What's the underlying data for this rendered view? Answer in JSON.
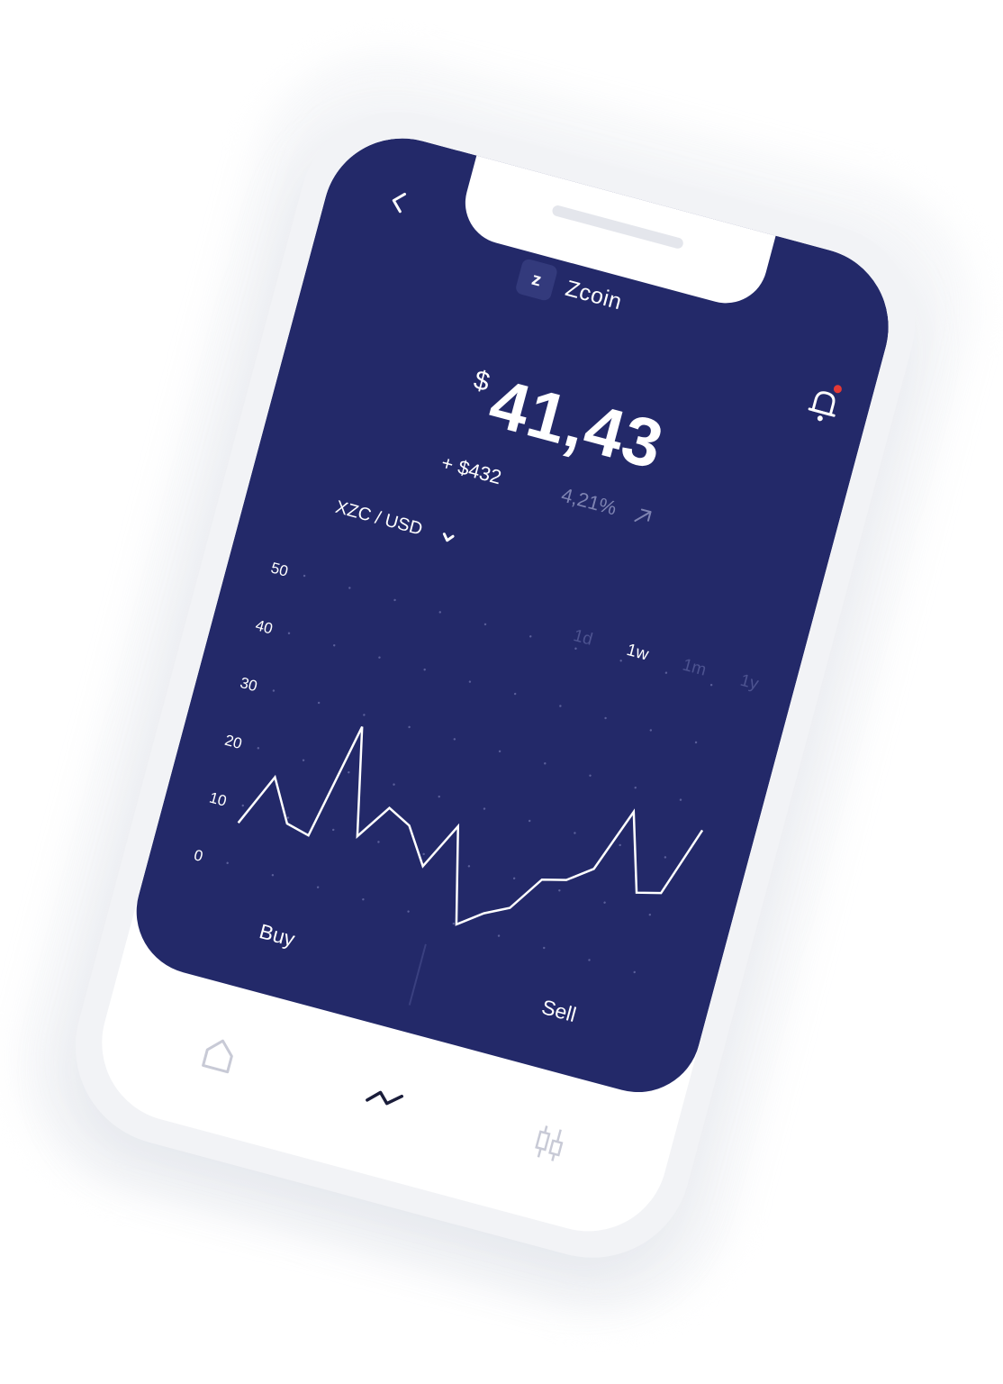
{
  "header": {
    "coin_name": "Zcoin",
    "coin_symbol_glyph": "z",
    "back_icon": "chevron-left-icon",
    "notification_icon": "bell-icon",
    "has_notification": true
  },
  "price": {
    "currency": "$",
    "value": "41,43",
    "change_abs": "+ $432",
    "change_pct": "4,21%",
    "trend_icon": "arrow-up-right-icon"
  },
  "pair": {
    "label": "XZC / USD",
    "chevron_icon": "chevron-down-icon"
  },
  "ranges": [
    {
      "label": "1d",
      "active": false
    },
    {
      "label": "1w",
      "active": true
    },
    {
      "label": "1m",
      "active": false
    },
    {
      "label": "1y",
      "active": false
    }
  ],
  "chart_data": {
    "type": "line",
    "title": "",
    "xlabel": "",
    "ylabel": "",
    "yticks": [
      "50",
      "40",
      "30",
      "20",
      "10",
      "0"
    ],
    "ylim": [
      0,
      50
    ],
    "grid": "dotted",
    "series": [
      {
        "values": [
          7,
          16,
          9,
          8,
          28,
          10,
          16,
          14,
          8,
          16,
          0,
          3,
          5,
          11,
          12,
          15,
          26,
          13,
          14,
          26
        ]
      }
    ]
  },
  "actions": {
    "buy_label": "Buy",
    "sell_label": "Sell"
  },
  "tabbar": {
    "items": [
      {
        "icon": "home-icon",
        "active": false
      },
      {
        "icon": "chart-line-icon",
        "active": true
      },
      {
        "icon": "candlestick-icon",
        "active": false
      }
    ]
  },
  "colors": {
    "screen_bg": "#232969",
    "accent_dot": "#e53935",
    "muted_text": "#7e83b2",
    "tab_inactive": "#c8cad6",
    "tab_active": "#1a1d3a"
  }
}
